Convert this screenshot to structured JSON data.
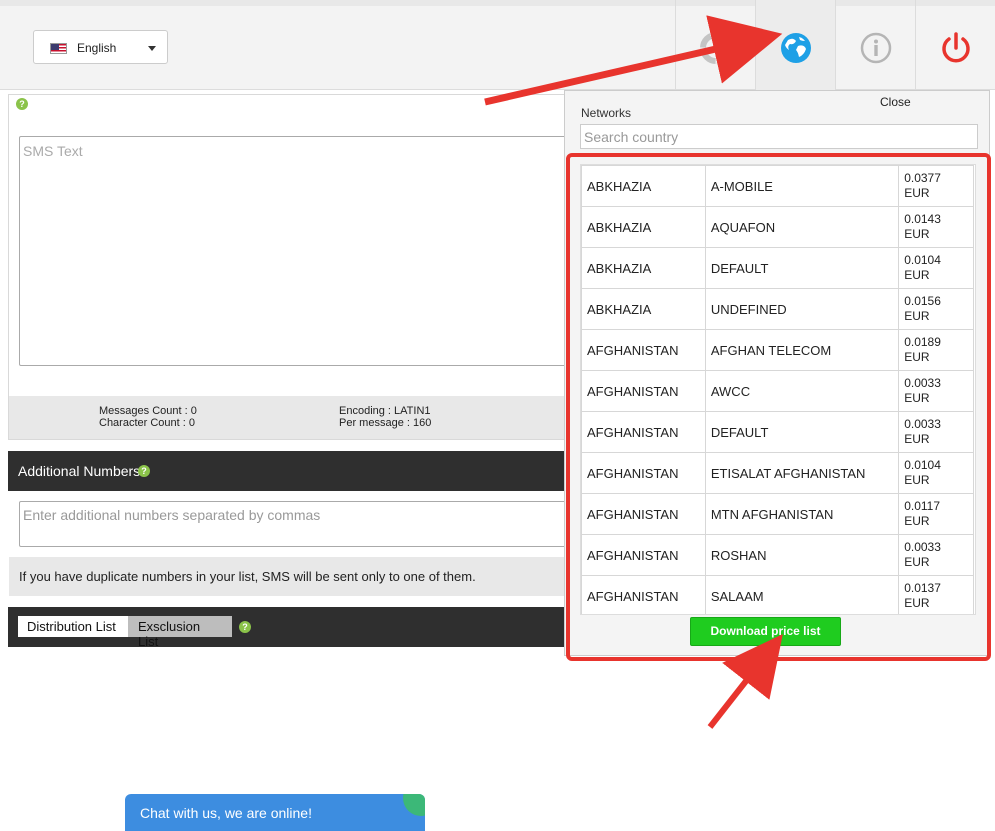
{
  "header": {
    "language": "English",
    "icons": [
      "lifebuoy-icon",
      "globe-icon",
      "info-icon",
      "power-icon"
    ]
  },
  "composer": {
    "sms_placeholder": "SMS Text",
    "messages_count": "Messages Count : 0",
    "character_count": "Character Count : 0",
    "encoding": "Encoding : LATIN1",
    "per_message": "Per message : 160"
  },
  "additional": {
    "title": "Additional Numbers",
    "placeholder": "Enter additional numbers separated by commas",
    "duplicate_note": "If you have duplicate numbers in your list, SMS will be sent only to one of them."
  },
  "lists": {
    "tab_distribution": "Distribution List",
    "tab_exclusion": "Exsclusion List"
  },
  "chat": {
    "label": "Chat with us, we are online!"
  },
  "networks": {
    "title": "Networks",
    "close": "Close",
    "search_placeholder": "Search country",
    "rows": [
      {
        "country": "ABKHAZIA",
        "network": "A-MOBILE",
        "price": "0.0377",
        "currency": "EUR"
      },
      {
        "country": "ABKHAZIA",
        "network": "AQUAFON",
        "price": "0.0143",
        "currency": "EUR"
      },
      {
        "country": "ABKHAZIA",
        "network": "DEFAULT",
        "price": "0.0104",
        "currency": "EUR"
      },
      {
        "country": "ABKHAZIA",
        "network": "UNDEFINED",
        "price": "0.0156",
        "currency": "EUR"
      },
      {
        "country": "AFGHANISTAN",
        "network": "AFGHAN TELECOM",
        "price": "0.0189",
        "currency": "EUR"
      },
      {
        "country": "AFGHANISTAN",
        "network": "AWCC",
        "price": "0.0033",
        "currency": "EUR"
      },
      {
        "country": "AFGHANISTAN",
        "network": "DEFAULT",
        "price": "0.0033",
        "currency": "EUR"
      },
      {
        "country": "AFGHANISTAN",
        "network": "ETISALAT AFGHANISTAN",
        "price": "0.0104",
        "currency": "EUR"
      },
      {
        "country": "AFGHANISTAN",
        "network": "MTN AFGHANISTAN",
        "price": "0.0117",
        "currency": "EUR"
      },
      {
        "country": "AFGHANISTAN",
        "network": "ROSHAN",
        "price": "0.0033",
        "currency": "EUR"
      },
      {
        "country": "AFGHANISTAN",
        "network": "SALAAM",
        "price": "0.0137",
        "currency": "EUR"
      }
    ],
    "download_label": "Download price list"
  },
  "colors": {
    "annotation": "#e8342d",
    "download": "#1fcc1f",
    "globe": "#1ea0e6",
    "power": "#e8342d",
    "chat": "#3d8de0"
  }
}
